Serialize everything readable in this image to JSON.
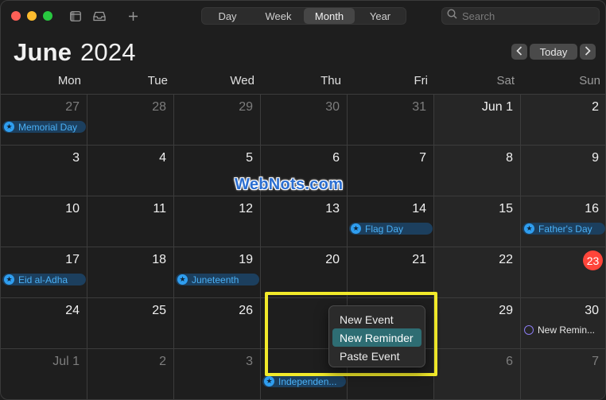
{
  "toolbar": {
    "views": [
      {
        "label": "Day",
        "active": false
      },
      {
        "label": "Week",
        "active": false
      },
      {
        "label": "Month",
        "active": true
      },
      {
        "label": "Year",
        "active": false
      }
    ],
    "search_placeholder": "Search"
  },
  "header": {
    "month": "June",
    "year": "2024",
    "today_label": "Today",
    "prev_icon": "chevron-left-icon",
    "next_icon": "chevron-right-icon"
  },
  "weekdays": [
    "Mon",
    "Tue",
    "Wed",
    "Thu",
    "Fri",
    "Sat",
    "Sun"
  ],
  "weeks": [
    [
      {
        "label": "27",
        "dim": true,
        "events": [
          {
            "type": "holiday",
            "title": "Memorial Day"
          }
        ]
      },
      {
        "label": "28",
        "dim": true
      },
      {
        "label": "29",
        "dim": true
      },
      {
        "label": "30",
        "dim": true
      },
      {
        "label": "31",
        "dim": true
      },
      {
        "label": "Jun 1"
      },
      {
        "label": "2"
      }
    ],
    [
      {
        "label": "3"
      },
      {
        "label": "4"
      },
      {
        "label": "5"
      },
      {
        "label": "6"
      },
      {
        "label": "7"
      },
      {
        "label": "8"
      },
      {
        "label": "9"
      }
    ],
    [
      {
        "label": "10"
      },
      {
        "label": "11"
      },
      {
        "label": "12"
      },
      {
        "label": "13"
      },
      {
        "label": "14",
        "events": [
          {
            "type": "holiday",
            "title": "Flag Day"
          }
        ]
      },
      {
        "label": "15"
      },
      {
        "label": "16",
        "events": [
          {
            "type": "holiday",
            "title": "Father's Day"
          }
        ]
      }
    ],
    [
      {
        "label": "17",
        "events": [
          {
            "type": "holiday",
            "title": "Eid al-Adha"
          }
        ]
      },
      {
        "label": "18"
      },
      {
        "label": "19",
        "events": [
          {
            "type": "holiday",
            "title": "Juneteenth"
          }
        ]
      },
      {
        "label": "20"
      },
      {
        "label": "21"
      },
      {
        "label": "22"
      },
      {
        "label": "23",
        "today": true
      }
    ],
    [
      {
        "label": "24"
      },
      {
        "label": "25"
      },
      {
        "label": "26"
      },
      {
        "label": "2"
      },
      {
        "label": ""
      },
      {
        "label": "29"
      },
      {
        "label": "30",
        "events": [
          {
            "type": "reminder",
            "title": "New Remin..."
          }
        ]
      }
    ],
    [
      {
        "label": "Jul 1",
        "dim": true
      },
      {
        "label": "2",
        "dim": true
      },
      {
        "label": "3",
        "dim": true
      },
      {
        "label": "",
        "dim": true,
        "events": [
          {
            "type": "holiday",
            "title": "Independen..."
          }
        ]
      },
      {
        "label": "",
        "dim": true
      },
      {
        "label": "6",
        "dim": true
      },
      {
        "label": "7",
        "dim": true
      }
    ]
  ],
  "context_menu": {
    "items": [
      {
        "label": "New Event",
        "selected": false
      },
      {
        "label": "New Reminder",
        "selected": true
      },
      {
        "label": "Paste Event",
        "selected": false
      }
    ]
  },
  "watermark": "WebNots.com",
  "colors": {
    "accent_today": "#ff453a",
    "event_fill": "#1c3f5e",
    "event_text": "#4ab0f5",
    "highlight": "#f2ea2a",
    "menu_selected": "#2e6d73"
  }
}
